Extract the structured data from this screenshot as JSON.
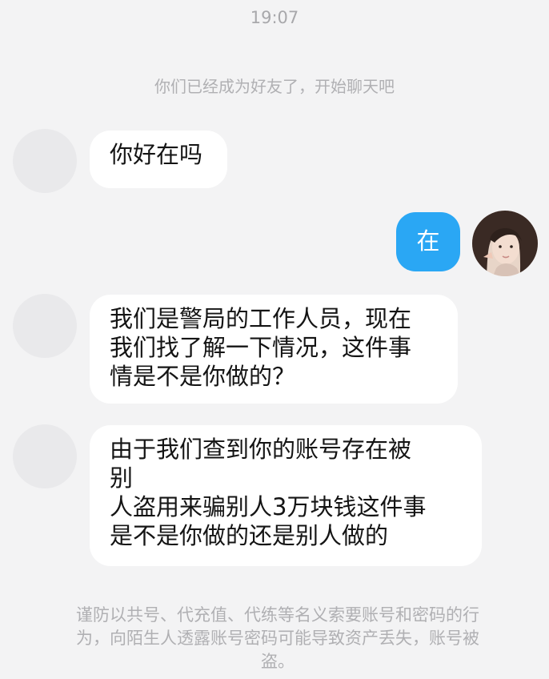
{
  "header": {
    "time": "19:07",
    "friend_notice": "你们已经成为好友了，开始聊天吧"
  },
  "messages": [
    {
      "side": "incoming",
      "lines": [
        "你好在吗"
      ]
    },
    {
      "side": "outgoing",
      "lines": [
        "在"
      ]
    },
    {
      "side": "incoming",
      "lines": [
        "我们是警局的工作人员，现在",
        "我们找了解一下情况，这件事",
        "情是不是你做的？"
      ]
    },
    {
      "side": "incoming",
      "lines": [
        "由于我们查到你的账号存在被",
        "别",
        "人盗用来骗别人3万块钱这件事",
        "是不是你做的还是别人做的"
      ]
    }
  ],
  "footer": {
    "warning_lines": [
      "谨防以共号、代充值、代练等名义索要账号和密码的行",
      "为，向陌生人透露账号密码可能导致资产丢失，账号被",
      "盗。"
    ]
  },
  "colors": {
    "background": "#f3f3f4",
    "incoming_bubble": "#ffffff",
    "outgoing_bubble": "#2aa7f4",
    "muted_text": "#b0b0b3"
  }
}
